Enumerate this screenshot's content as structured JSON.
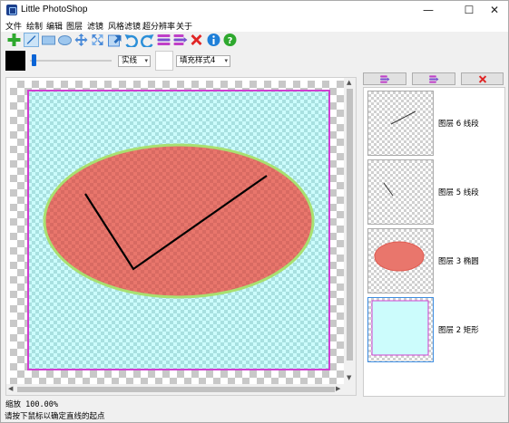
{
  "window": {
    "title": "Little PhotoShop",
    "controls": {
      "minimize": "—",
      "maximize": "☐",
      "close": "✕"
    }
  },
  "menu": [
    "文件",
    "绘制",
    "编辑",
    "图层",
    "滤镜",
    "风格滤镜",
    "超分辨率",
    "关于"
  ],
  "toolbar": {
    "tools": [
      "add-icon",
      "line-tool-icon",
      "rectangle-tool-icon",
      "ellipse-tool-icon",
      "move-icon",
      "transform-icon",
      "resize-icon",
      "undo-icon",
      "redo-icon",
      "layer-icon",
      "layer-add-icon",
      "delete-icon",
      "info-icon",
      "help-icon"
    ]
  },
  "options": {
    "stroke_color": "#000000",
    "line_width": 0.04,
    "line_style": "实线",
    "fill_color": "#ffffff",
    "fill_style": "填充样式4"
  },
  "canvas": {
    "rectangle": {
      "fill": "#ccfcfc",
      "border": "#d040d0"
    },
    "ellipse": {
      "fill": "#e9766c",
      "border": "#a8e070"
    },
    "polyline": {
      "color": "#000000"
    }
  },
  "layers_panel": {
    "buttons": [
      "move-layer-up-icon",
      "move-layer-down-icon",
      "delete-layer-icon"
    ],
    "layers": [
      {
        "label": "图层 6 线段"
      },
      {
        "label": "图层 5 线段"
      },
      {
        "label": "图层 3 椭圆"
      },
      {
        "label": "图层 2 矩形"
      }
    ]
  },
  "zoom": "缩放 100.00%",
  "status": "请按下鼠标以确定直线的起点"
}
